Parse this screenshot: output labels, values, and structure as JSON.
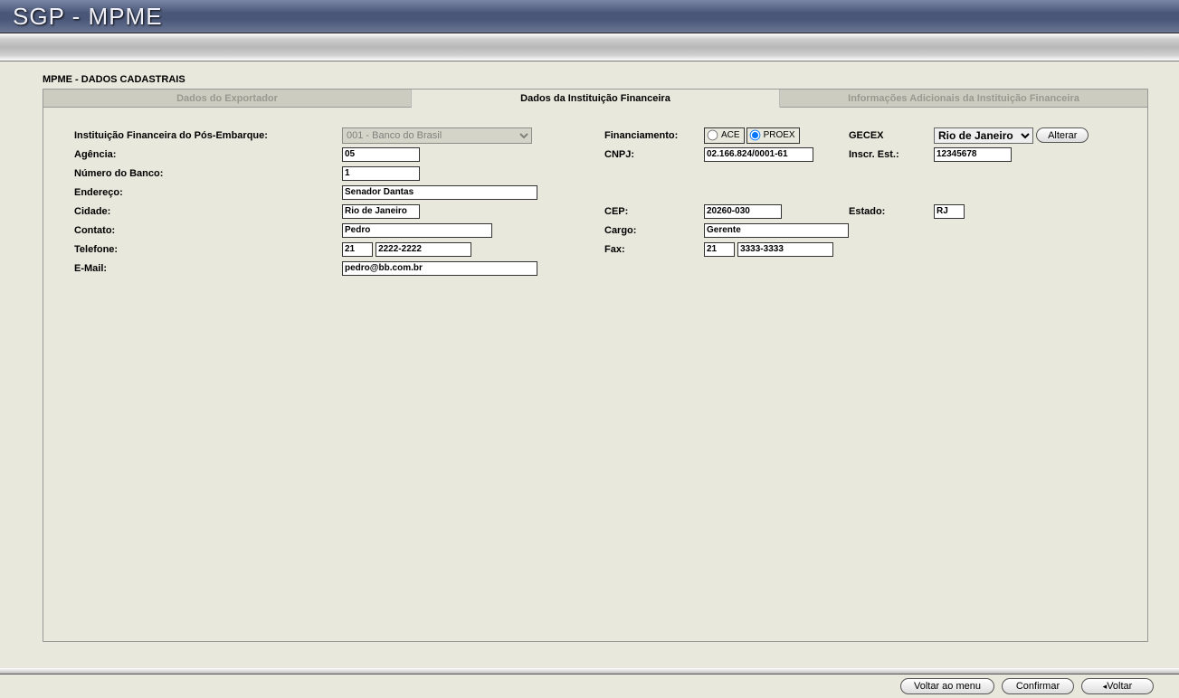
{
  "app_title": "SGP - MPME",
  "section_title": "MPME - DADOS CADASTRAIS",
  "tabs": {
    "exportador": "Dados do Exportador",
    "instituicao": "Dados da Instituição Financeira",
    "adicionais": "Informações Adicionais da Instituição Financeira"
  },
  "labels": {
    "instituicao": "Instituição Financeira do Pós-Embarque:",
    "agencia": "Agência:",
    "numero_banco": "Número do Banco:",
    "endereco": "Endereço:",
    "cidade": "Cidade:",
    "contato": "Contato:",
    "telefone": "Telefone:",
    "email": "E-Mail:",
    "financiamento": "Financiamento:",
    "cnpj": "CNPJ:",
    "cep": "CEP:",
    "cargo": "Cargo:",
    "fax": "Fax:",
    "gecex": "GECEX",
    "inscr_est": "Inscr. Est.:",
    "estado": "Estado:"
  },
  "values": {
    "instituicao_select": "001 - Banco do Brasil",
    "agencia": "05",
    "numero_banco": "1",
    "endereco": "Senador Dantas",
    "cidade": "Rio de Janeiro",
    "contato": "Pedro",
    "tel_ddd": "21",
    "tel_num": "2222-2222",
    "email": "pedro@bb.com.br",
    "fin_ace": "ACE",
    "fin_proex": "PROEX",
    "cnpj": "02.166.824/0001-61",
    "cep": "20260-030",
    "estado": "RJ",
    "cargo": "Gerente",
    "fax_ddd": "21",
    "fax_num": "3333-3333",
    "gecex_select": "Rio de Janeiro",
    "inscr_est": "12345678"
  },
  "buttons": {
    "alterar": "Alterar",
    "voltar_menu": "Voltar ao menu",
    "confirmar": "Confirmar",
    "voltar": "Voltar"
  }
}
